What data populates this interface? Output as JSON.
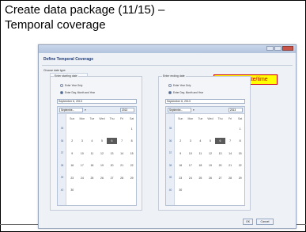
{
  "slide": {
    "title_line1": "Create data package (11/15) –",
    "title_line2": "Temporal coverage"
  },
  "dialog": {
    "heading": "Define Temporal Coverage",
    "choose_label": "Choose date type:",
    "options": [
      "Single Point in Time",
      "Range of Date/Time"
    ],
    "selected_option": "Range of Date/Time",
    "start_panel_label": "Enter starting date",
    "end_panel_label": "Enter ending date",
    "enter_year_only": "Enter Year Only",
    "enter_day_month_year": "Enter Day, Month and Year",
    "start_date_value": "September 6, 2013",
    "end_date_value": "September 6, 2013",
    "month": "Septembe...",
    "year": "2013",
    "weekdays": [
      "Sun",
      "Mon",
      "Tue",
      "Wed",
      "Thu",
      "Fri",
      "Sat"
    ],
    "weeks": [
      "35",
      "36",
      "37",
      "38",
      "39",
      "40"
    ],
    "calendar_rows": [
      [
        "",
        "",
        "",
        "",
        "",
        "",
        "1"
      ],
      [
        "2",
        "3",
        "4",
        "5",
        "6",
        "7",
        "8"
      ],
      [
        "9",
        "10",
        "11",
        "12",
        "13",
        "14",
        "15"
      ],
      [
        "16",
        "17",
        "18",
        "19",
        "20",
        "21",
        "22"
      ],
      [
        "23",
        "24",
        "25",
        "26",
        "27",
        "28",
        "29"
      ],
      [
        "30",
        "",
        "",
        "",
        "",
        "",
        ""
      ]
    ],
    "selected_day": "6",
    "ok_label": "OK",
    "cancel_label": "Cancel"
  },
  "callout": {
    "text": "range of date/time"
  },
  "colors": {
    "callout_bg": "#ffff00",
    "callout_border": "#d00000",
    "callout_text": "#c00000",
    "dialog_heading": "#1d3a75"
  }
}
